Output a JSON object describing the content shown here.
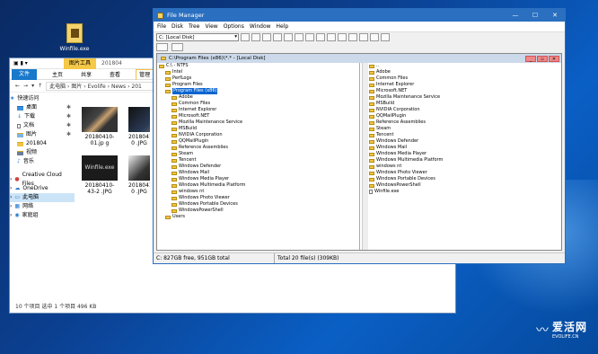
{
  "desktop": {
    "icon_label": "Winfile.exe"
  },
  "explorer": {
    "title_tab": "图片工具",
    "title_folder": "201804",
    "ribbon": [
      "文件",
      "主页",
      "共享",
      "查看",
      "管理"
    ],
    "breadcrumb": [
      "此电脑",
      "图片",
      "Evolife",
      "News",
      "201"
    ],
    "nav": [
      {
        "label": "快速访问",
        "icon": "star-icon"
      },
      {
        "label": "桌面",
        "pin": "✱"
      },
      {
        "label": "下载",
        "pin": "✱"
      },
      {
        "label": "文档",
        "pin": "✱"
      },
      {
        "label": "图片",
        "pin": "✱"
      },
      {
        "label": "201804"
      },
      {
        "label": "视频"
      },
      {
        "label": "音乐"
      },
      {
        "label": ""
      },
      {
        "label": "Creative Cloud Files"
      },
      {
        "label": "OneDrive"
      },
      {
        "label": "此电脑",
        "selected": true
      },
      {
        "label": "网络"
      },
      {
        "label": "家庭组"
      }
    ],
    "thumbs": [
      {
        "label": "20180410-01.jp g"
      },
      {
        "label": "20180410-0 .JPG"
      },
      {
        "label": "Winfile.exe"
      },
      {
        "label": "20180410-43-2 .JPG"
      },
      {
        "label": "20180410-0 .JPG"
      }
    ],
    "status": "10 个项目    选中 1 个项目  496 KB"
  },
  "fm": {
    "title": "File Manager",
    "menu": [
      "File",
      "Disk",
      "Tree",
      "View",
      "Options",
      "Window",
      "Help"
    ],
    "drive": "C: [Local Disk]",
    "child_title": "C:\\Program Files (x86)\\*.* - [Local Disk]",
    "tree": [
      {
        "name": "C:\\ - NTFS",
        "lvl": 0
      },
      {
        "name": "Intel",
        "lvl": 1
      },
      {
        "name": "PerfLogs",
        "lvl": 1
      },
      {
        "name": "Program Files",
        "lvl": 1
      },
      {
        "name": "Program Files (x86)",
        "lvl": 1,
        "sel": true
      },
      {
        "name": "Adobe",
        "lvl": 2
      },
      {
        "name": "Common Files",
        "lvl": 2
      },
      {
        "name": "Internet Explorer",
        "lvl": 2
      },
      {
        "name": "Microsoft.NET",
        "lvl": 2
      },
      {
        "name": "Mozilla Maintenance Service",
        "lvl": 2
      },
      {
        "name": "MSBuild",
        "lvl": 2
      },
      {
        "name": "NVIDIA Corporation",
        "lvl": 2
      },
      {
        "name": "QQMailPlugin",
        "lvl": 2
      },
      {
        "name": "Reference Assemblies",
        "lvl": 2
      },
      {
        "name": "Steam",
        "lvl": 2
      },
      {
        "name": "Tencent",
        "lvl": 2
      },
      {
        "name": "Windows Defender",
        "lvl": 2
      },
      {
        "name": "Windows Mail",
        "lvl": 2
      },
      {
        "name": "Windows Media Player",
        "lvl": 2
      },
      {
        "name": "Windows Multimedia Platform",
        "lvl": 2
      },
      {
        "name": "windows nt",
        "lvl": 2
      },
      {
        "name": "Windows Photo Viewer",
        "lvl": 2
      },
      {
        "name": "Windows Portable Devices",
        "lvl": 2
      },
      {
        "name": "WindowsPowerShell",
        "lvl": 2
      },
      {
        "name": "Users",
        "lvl": 1
      }
    ],
    "list": [
      {
        "name": "..",
        "type": "up"
      },
      {
        "name": "Adobe"
      },
      {
        "name": "Common Files"
      },
      {
        "name": "Internet Explorer"
      },
      {
        "name": "Microsoft.NET"
      },
      {
        "name": "Mozilla Maintenance Service"
      },
      {
        "name": "MSBuild"
      },
      {
        "name": "NVIDIA Corporation"
      },
      {
        "name": "QQMailPlugin"
      },
      {
        "name": "Reference Assemblies"
      },
      {
        "name": "Steam"
      },
      {
        "name": "Tencent"
      },
      {
        "name": "Windows Defender"
      },
      {
        "name": "Windows Mail"
      },
      {
        "name": "Windows Media Player"
      },
      {
        "name": "Windows Multimedia Platform"
      },
      {
        "name": "windows nt"
      },
      {
        "name": "Windows Photo Viewer"
      },
      {
        "name": "Windows Portable Devices"
      },
      {
        "name": "WindowsPowerShell"
      },
      {
        "name": "Winfile.exe",
        "type": "file"
      }
    ],
    "status_left": "C: 827GB free,  951GB total",
    "status_right": "Total 20 file(s) (309KB)"
  },
  "watermark": {
    "cn": "爱活网",
    "en": "EVOLIFE.CN"
  }
}
